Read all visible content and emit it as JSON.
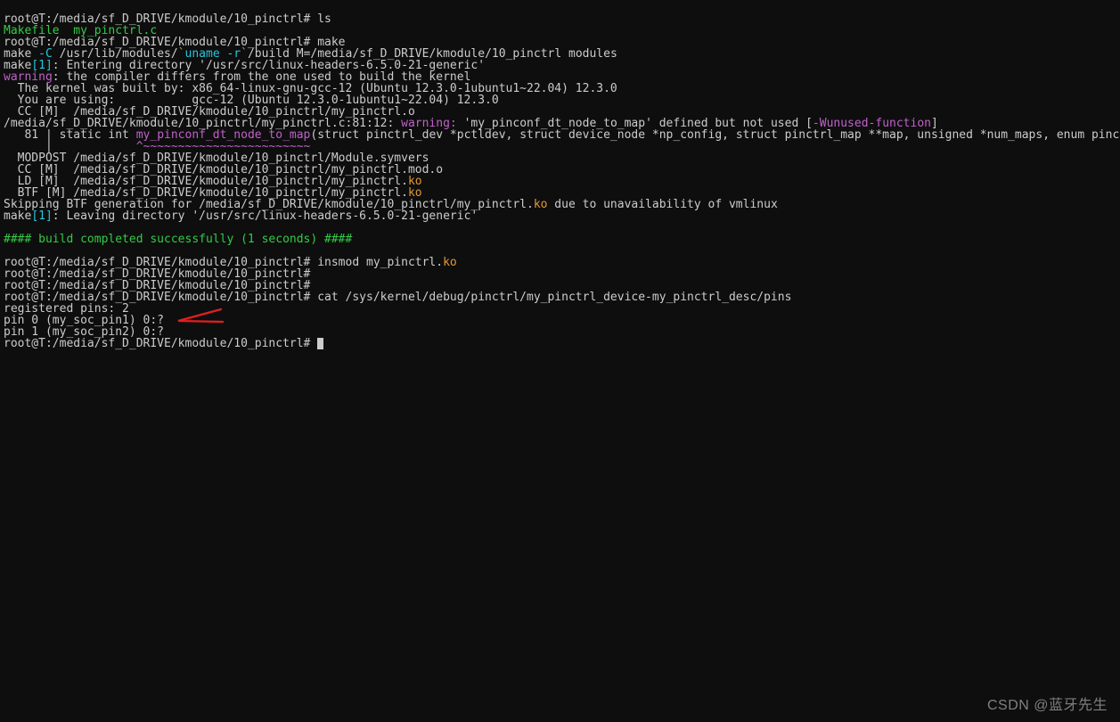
{
  "prompt_prefix": "root@T:/media/sf_D_DRIVE/kmodule/10_pinctrl#",
  "cmds": {
    "ls": "ls",
    "make": "make",
    "insmod": "insmod my_pinctrl.",
    "insmod_ext": "ko",
    "cat": "cat /sys/kernel/debug/pinctrl/my_pinctrl_device-my_pinctrl_desc/pins"
  },
  "ls_out": {
    "file1": "Makefile",
    "file2": "my_pinctrl.c"
  },
  "make_line": {
    "p1": "make ",
    "p2": "-C",
    "p3": " /usr/lib/modules/",
    "p4": "`",
    "p5": "uname -r",
    "p6": "`",
    "p7": "/build M=/media/sf_D_DRIVE/kmodule/10_pinctrl modules"
  },
  "make_enter": {
    "p1": "make",
    "p2": "[",
    "p3": "1",
    "p4": "]",
    "p5": ": Entering directory '/usr/src/linux-headers-6.5.0-21-generic'"
  },
  "warn1": {
    "label": "warning",
    "msg": ": the compiler differs from the one used to build the kernel"
  },
  "kernel_built": "  The kernel was built by: x86_64-linux-gnu-gcc-12 (Ubuntu 12.3.0-1ubuntu1~22.04) 12.3.0",
  "you_using": "  You are using:           gcc-12 (Ubuntu 12.3.0-1ubuntu1~22.04) 12.3.0",
  "cc_line": "  CC [M]  /media/sf_D_DRIVE/kmodule/10_pinctrl/my_pinctrl.o",
  "warn_path": "/media/sf_D_DRIVE/kmodule/10_pinctrl/my_pinctrl.c:81:12: ",
  "warn_label": "warning: ",
  "warn_msg1": "'",
  "warn_func": "my_pinconf_dt_node_to_map",
  "warn_msg2": "' defined but not used ",
  "warn_open": "[",
  "warn_flag": "-Wunused-function",
  "warn_close": "]",
  "code_line1a": "   81 | static int ",
  "code_func": "my_pinconf_dt_node_to_map",
  "code_line1b": "(struct pinctrl_dev *pctldev, struct device_node *np_config, struct pinctrl_map **map, unsigned *num_maps, enum pinctrl_map_type type)",
  "code_line2a": "      |            ",
  "code_caret": "^~~~~~~~~~~~~~~~~~~~~~~~~",
  "modpost": "  MODPOST /media/sf_D_DRIVE/kmodule/10_pinctrl/Module.symvers",
  "cc_mod": "  CC [M]  /media/sf_D_DRIVE/kmodule/10_pinctrl/my_pinctrl.mod.o",
  "ld_ko_a": "  LD [M]  /media/sf_D_DRIVE/kmodule/10_pinctrl/my_pinctrl.",
  "ld_ko_b": "ko",
  "btf_ko_a": "  BTF [M] /media/sf_D_DRIVE/kmodule/10_pinctrl/my_pinctrl.",
  "btf_ko_b": "ko",
  "skip_btf_a": "Skipping BTF generation for /media/sf_D_DRIVE/kmodule/10_pinctrl/my_pinctrl.",
  "skip_btf_b": "ko",
  "skip_btf_c": " due to unavailability of vmlinux",
  "make_leave": {
    "p1": "make",
    "p2": "[",
    "p3": "1",
    "p4": "]",
    "p5": ": Leaving directory '/usr/src/linux-headers-6.5.0-21-generic'"
  },
  "build_ok": "#### build completed successfully (1 seconds) ####",
  "cat_out": {
    "reg": "registered pins: 2",
    "p0": "pin 0 (my_soc_pin1) 0:?",
    "p1": "pin 1 (my_soc_pin2) 0:?"
  },
  "watermark": "CSDN @蓝牙先生"
}
